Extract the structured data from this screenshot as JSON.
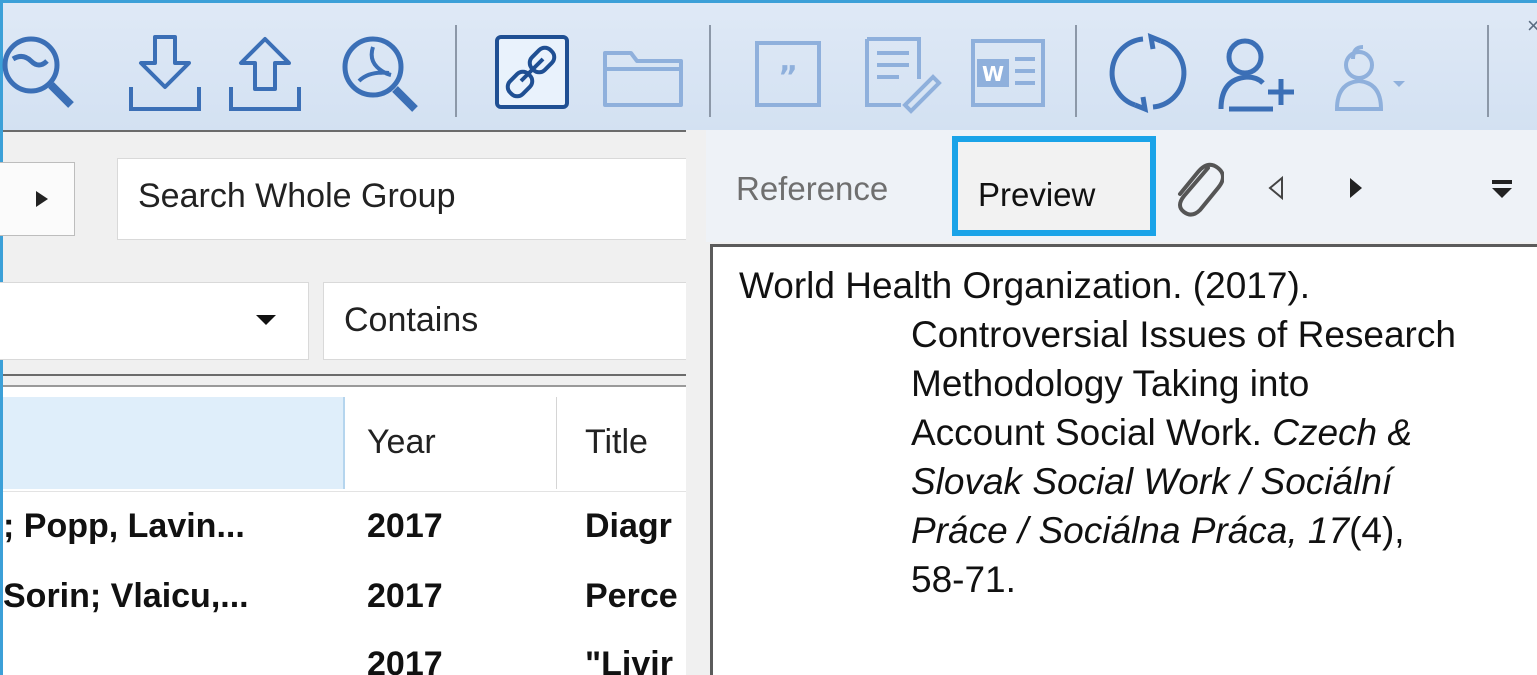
{
  "toolbar": {
    "icons": [
      "online-search-icon",
      "import-icon",
      "export-icon",
      "find-pdf-icon",
      "link-icon",
      "open-folder-icon",
      "insert-citation-icon",
      "format-bibliography-icon",
      "word-icon",
      "sync-icon",
      "share-group-icon",
      "group-activity-icon"
    ]
  },
  "search": {
    "scope": "Search Whole Group",
    "field": "",
    "operator": "Contains"
  },
  "table": {
    "columns": [
      "",
      "Year",
      "Title"
    ],
    "rows": [
      {
        "author": "; Popp, Lavin...",
        "year": "2017",
        "title": "Diagr"
      },
      {
        "author": "Sorin; Vlaicu,...",
        "year": "2017",
        "title": "Perce"
      },
      {
        "author": "",
        "year": "2017",
        "title": "\"Livir"
      }
    ]
  },
  "tabs": {
    "reference": "Reference",
    "preview": "Preview"
  },
  "citation": {
    "author_year": "World Health Organization. (2017).",
    "title_line1": "Controversial Issues of Research",
    "title_line2": "Methodology Taking into",
    "title_line3_plain": "Account Social Work. ",
    "journal_a": "Czech &",
    "journal_b": "Slovak Social Work / Sociální",
    "journal_c": "Práce / Sociálna Práca, 17",
    "issue": "(4),",
    "pages": "58-71."
  },
  "colors": {
    "accent": "#1aa3e8",
    "toolbar_bg": "#dae6f5",
    "icon_blue": "#3b6fb6",
    "icon_faded": "#8fb0dc",
    "header_selected": "#dfeefa"
  }
}
